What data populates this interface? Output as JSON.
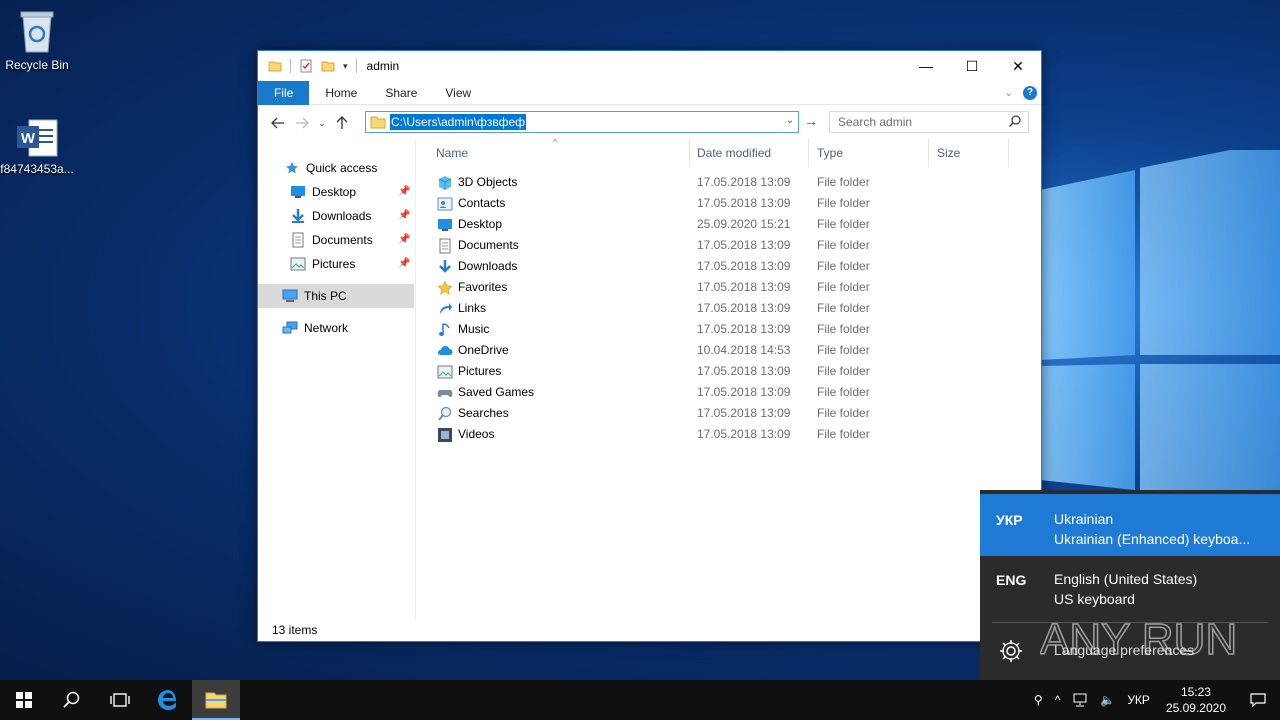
{
  "desktop": {
    "icons": [
      {
        "label": "Recycle Bin",
        "icon": "recycle-bin-icon"
      },
      {
        "label": "f84743453a...",
        "icon": "word-document-icon"
      }
    ]
  },
  "window": {
    "title": "admin",
    "caption": {
      "minimize": "—",
      "maximize": "☐",
      "close": "✕"
    },
    "ribbon_tabs": [
      "File",
      "Home",
      "Share",
      "View"
    ],
    "address": {
      "path": "C:\\Users\\admin\\фзвфеф"
    },
    "search": {
      "placeholder": "Search admin"
    },
    "nav_pane": {
      "quick_access": "Quick access",
      "pinned": [
        "Desktop",
        "Downloads",
        "Documents",
        "Pictures"
      ],
      "this_pc": "This PC",
      "network": "Network"
    },
    "columns": [
      "Name",
      "Date modified",
      "Type",
      "Size"
    ],
    "files": [
      {
        "name": "3D Objects",
        "date": "17.05.2018 13:09",
        "type": "File folder",
        "icon": "3d-objects-icon"
      },
      {
        "name": "Contacts",
        "date": "17.05.2018 13:09",
        "type": "File folder",
        "icon": "contacts-icon"
      },
      {
        "name": "Desktop",
        "date": "25.09.2020 15:21",
        "type": "File folder",
        "icon": "desktop-icon"
      },
      {
        "name": "Documents",
        "date": "17.05.2018 13:09",
        "type": "File folder",
        "icon": "documents-icon"
      },
      {
        "name": "Downloads",
        "date": "17.05.2018 13:09",
        "type": "File folder",
        "icon": "downloads-icon"
      },
      {
        "name": "Favorites",
        "date": "17.05.2018 13:09",
        "type": "File folder",
        "icon": "favorites-icon"
      },
      {
        "name": "Links",
        "date": "17.05.2018 13:09",
        "type": "File folder",
        "icon": "links-icon"
      },
      {
        "name": "Music",
        "date": "17.05.2018 13:09",
        "type": "File folder",
        "icon": "music-icon"
      },
      {
        "name": "OneDrive",
        "date": "10.04.2018 14:53",
        "type": "File folder",
        "icon": "onedrive-icon"
      },
      {
        "name": "Pictures",
        "date": "17.05.2018 13:09",
        "type": "File folder",
        "icon": "pictures-icon"
      },
      {
        "name": "Saved Games",
        "date": "17.05.2018 13:09",
        "type": "File folder",
        "icon": "saved-games-icon"
      },
      {
        "name": "Searches",
        "date": "17.05.2018 13:09",
        "type": "File folder",
        "icon": "searches-icon"
      },
      {
        "name": "Videos",
        "date": "17.05.2018 13:09",
        "type": "File folder",
        "icon": "videos-icon"
      }
    ],
    "status": "13 items"
  },
  "language_flyout": {
    "languages": [
      {
        "code": "УКР",
        "name": "Ukrainian",
        "keyboard": "Ukrainian (Enhanced) keyboa...",
        "active": true
      },
      {
        "code": "ENG",
        "name": "English (United States)",
        "keyboard": "US keyboard",
        "active": false
      }
    ],
    "preferences": "Language preferences"
  },
  "watermark": "ANY RUN",
  "taskbar": {
    "lang_indicator": "УКР",
    "time": "15:23",
    "date": "25.09.2020"
  },
  "colors": {
    "accent": "#1979ca",
    "flyout_active": "#1f7ad6",
    "flyout_bg": "#2b2b2b",
    "taskbar": "#101010"
  }
}
